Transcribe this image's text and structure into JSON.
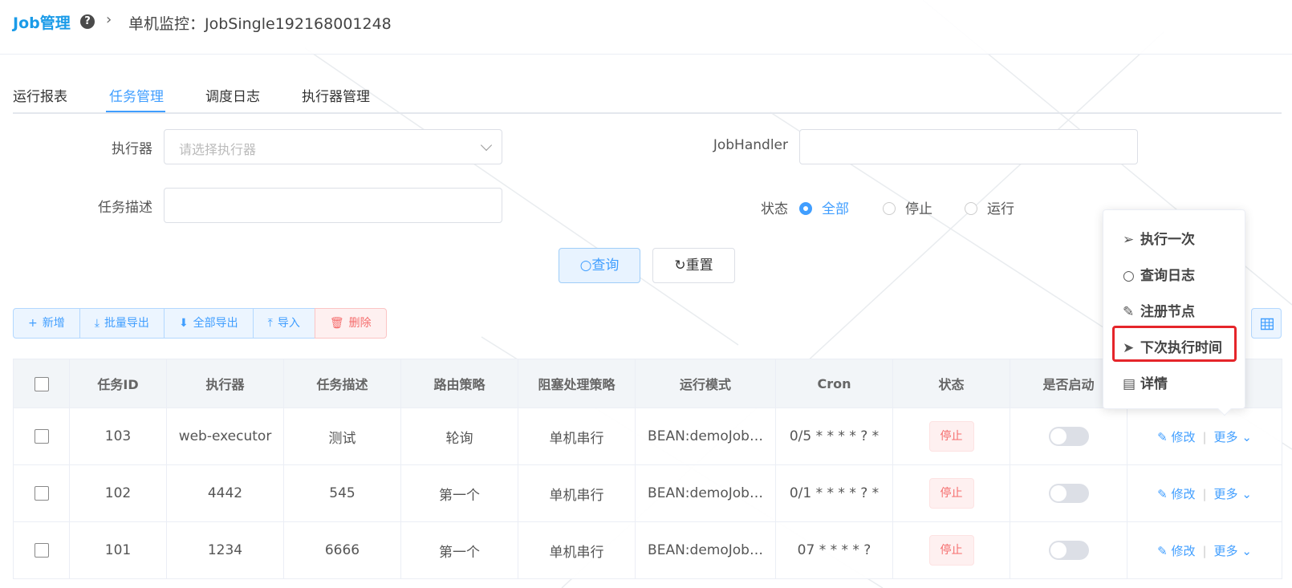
{
  "header": {
    "brand": "Job管理",
    "breadcrumb_current": "单机监控：JobSingle192168001248"
  },
  "tabs": [
    "运行报表",
    "任务管理",
    "调度日志",
    "执行器管理"
  ],
  "active_tab": "任务管理",
  "filters": {
    "executor_label": "执行器",
    "executor_placeholder": "请选择执行器",
    "jobhandler_label": "JobHandler",
    "jobhandler_value": "",
    "desc_label": "任务描述",
    "desc_value": "",
    "status_label": "状态",
    "status_options": [
      "全部",
      "停止",
      "运行"
    ],
    "status_selected": "全部"
  },
  "buttons": {
    "search": "查询",
    "reset": "重置"
  },
  "toolbar": {
    "add": "新增",
    "batch_export": "批量导出",
    "export_all": "全部导出",
    "import": "导入",
    "delete": "删除"
  },
  "table": {
    "columns": [
      "任务ID",
      "执行器",
      "任务描述",
      "路由策略",
      "阻塞处理策略",
      "运行模式",
      "Cron",
      "状态",
      "是否启动"
    ],
    "rows": [
      {
        "id": "103",
        "executor": "web-executor",
        "desc": "测试",
        "route": "轮询",
        "block": "单机串行",
        "mode": "BEAN:demoJob…",
        "cron": "0/5 * * * * ? *",
        "status": "停止",
        "enabled": false
      },
      {
        "id": "102",
        "executor": "4442",
        "desc": "545",
        "route": "第一个",
        "block": "单机串行",
        "mode": "BEAN:demoJob…",
        "cron": "0/1 * * * * ? *",
        "status": "停止",
        "enabled": false
      },
      {
        "id": "101",
        "executor": "1234",
        "desc": "6666",
        "route": "第一个",
        "block": "单机串行",
        "mode": "BEAN:demoJob…",
        "cron": "07 * * * * ?",
        "status": "停止",
        "enabled": false
      }
    ],
    "edit_label": "修改",
    "more_label": "更多"
  },
  "dropdown_menu": {
    "items": [
      "执行一次",
      "查询日志",
      "注册节点",
      "下次执行时间",
      "详情"
    ],
    "highlighted": "下次执行时间"
  },
  "colors": {
    "primary": "#409eff",
    "brand": "#1a9be8",
    "danger": "#f56c6c",
    "highlight": "#e5252a"
  }
}
